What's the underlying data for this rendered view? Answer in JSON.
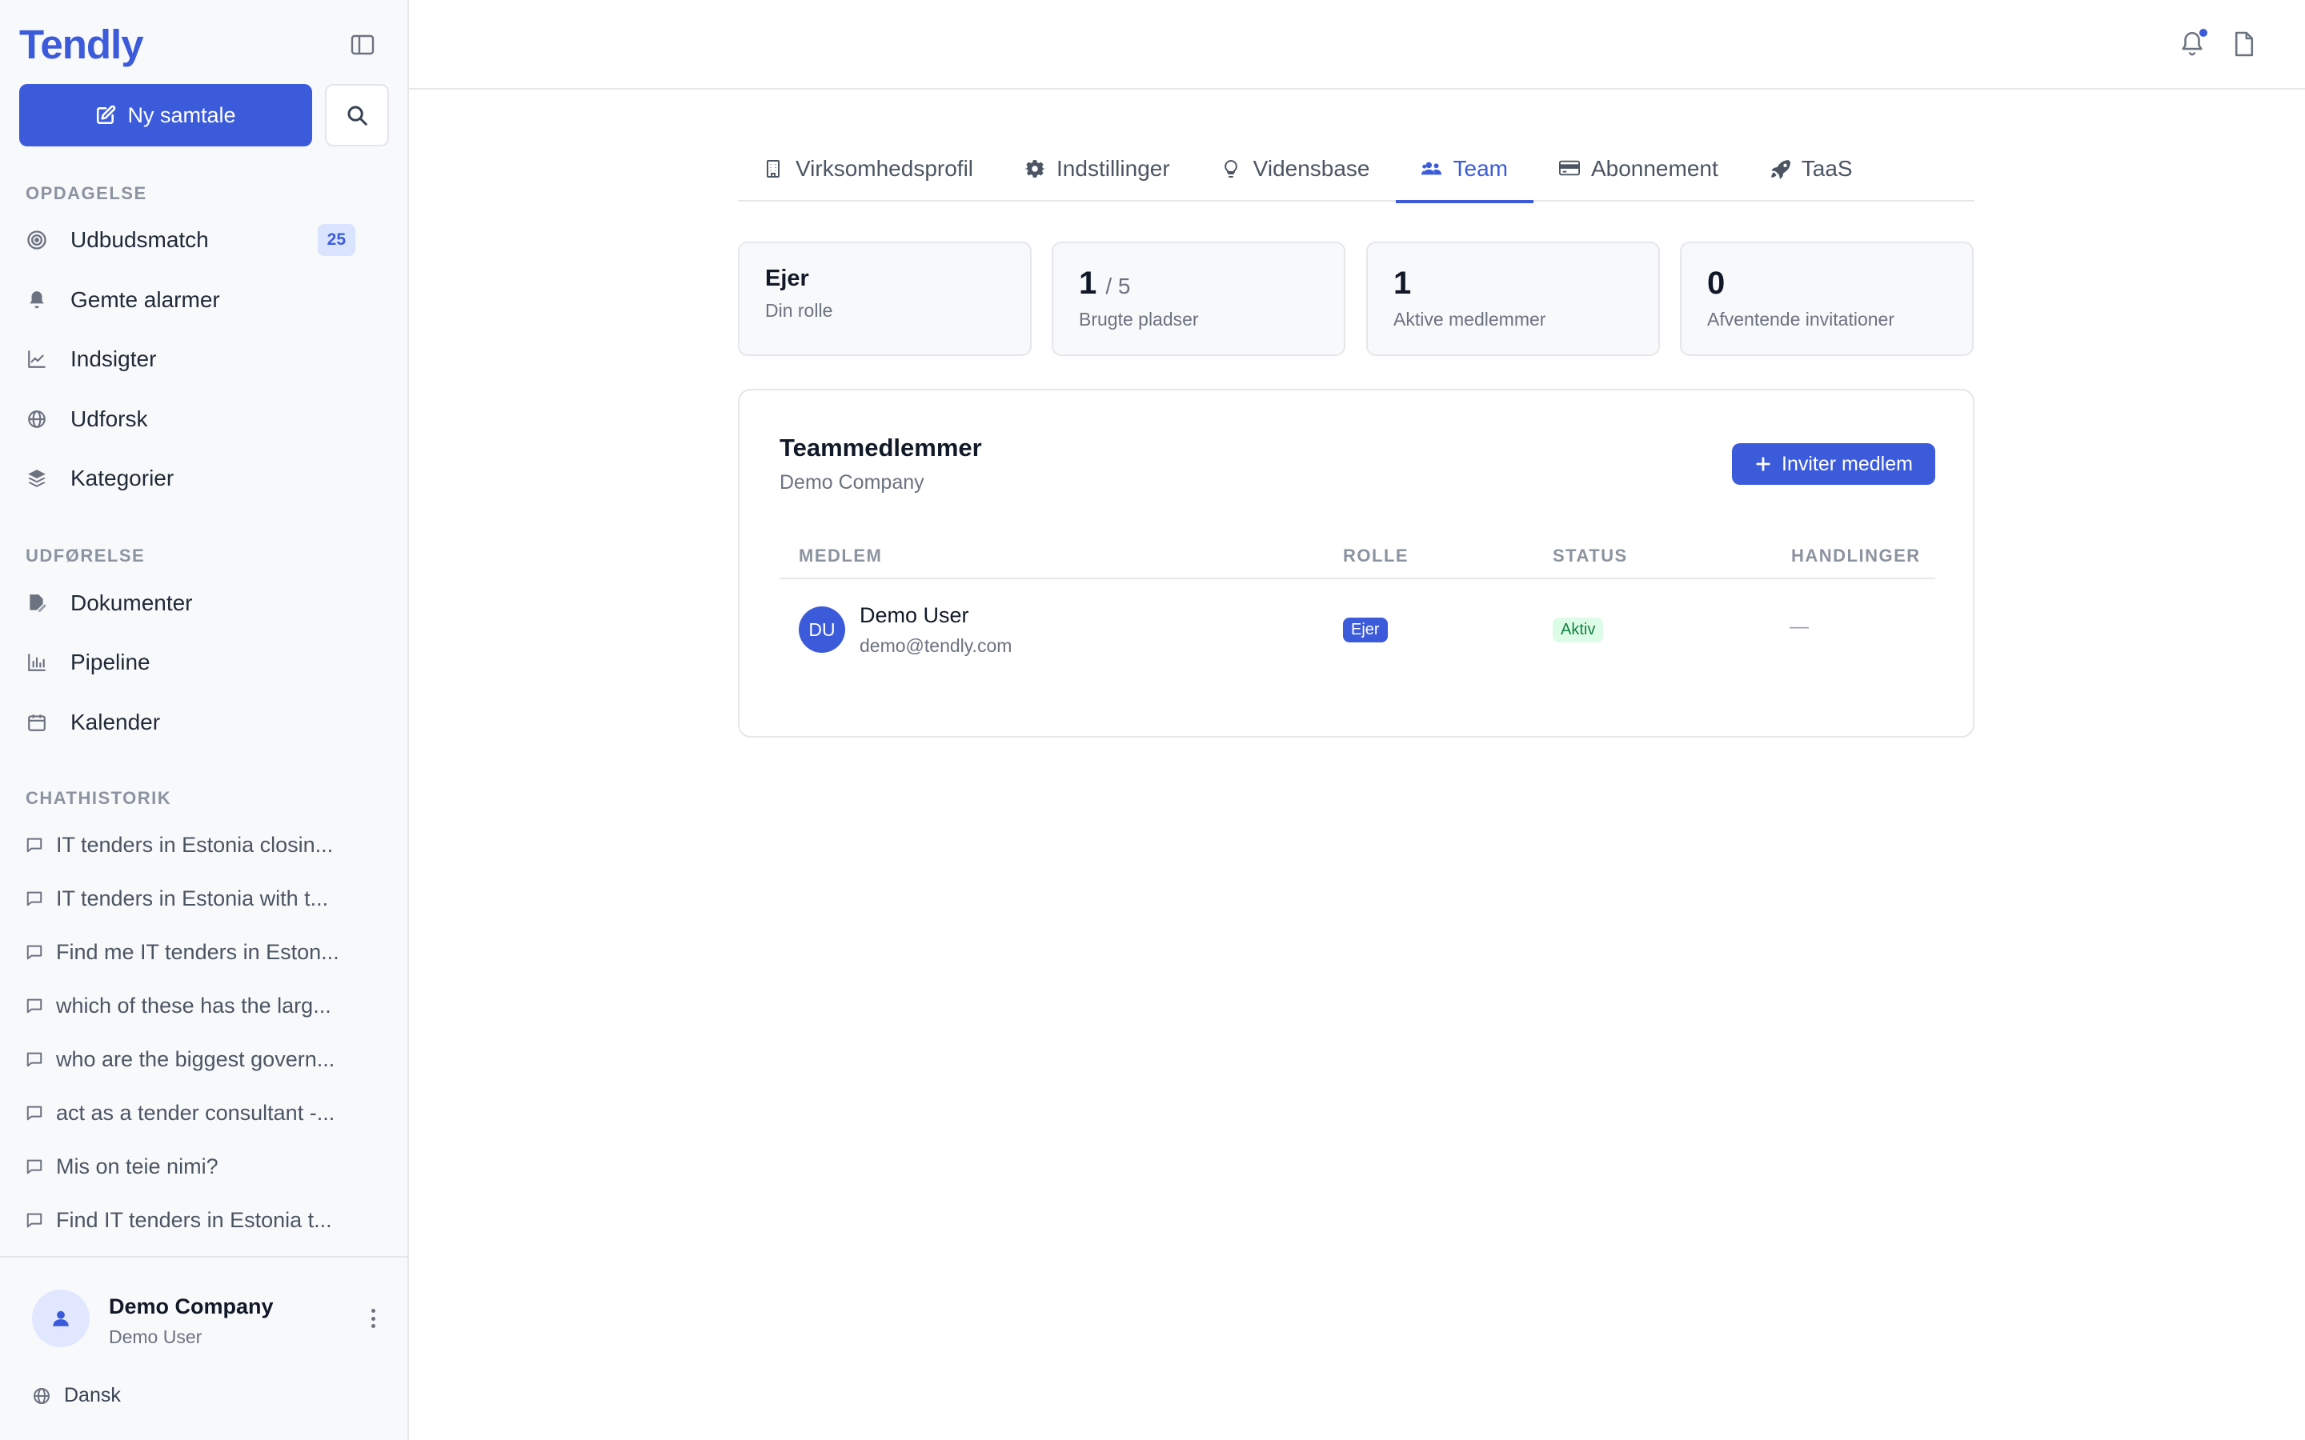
{
  "app": {
    "logo": "Tendly"
  },
  "sidebar": {
    "new_chat_label": "Ny samtale",
    "sections": {
      "discovery": "OPDAGELSE",
      "execution": "UDFØRELSE",
      "history": "CHATHISTORIK"
    },
    "discovery_items": [
      {
        "label": "Udbudsmatch",
        "icon": "target-icon",
        "badge": "25"
      },
      {
        "label": "Gemte alarmer",
        "icon": "bell-icon"
      },
      {
        "label": "Indsigter",
        "icon": "chart-line-icon"
      },
      {
        "label": "Udforsk",
        "icon": "globe-icon"
      },
      {
        "label": "Kategorier",
        "icon": "layers-icon"
      }
    ],
    "execution_items": [
      {
        "label": "Dokumenter",
        "icon": "file-edit-icon"
      },
      {
        "label": "Pipeline",
        "icon": "bar-chart-icon"
      },
      {
        "label": "Kalender",
        "icon": "calendar-icon"
      }
    ],
    "chat_history": [
      "IT tenders in Estonia closin...",
      "IT tenders in Estonia with t...",
      "Find me IT tenders in Eston...",
      "which of these has the larg...",
      "who are the biggest govern...",
      "act as a tender consultant -...",
      "Mis on teie nimi?",
      "Find IT tenders in Estonia t..."
    ],
    "footer": {
      "company": "Demo Company",
      "user": "Demo User",
      "language": "Dansk"
    }
  },
  "tabs": [
    {
      "label": "Virksomhedsprofil",
      "icon": "building-icon",
      "active": false
    },
    {
      "label": "Indstillinger",
      "icon": "gear-icon",
      "active": false
    },
    {
      "label": "Vidensbase",
      "icon": "lightbulb-icon",
      "active": false
    },
    {
      "label": "Team",
      "icon": "users-icon",
      "active": true
    },
    {
      "label": "Abonnement",
      "icon": "credit-card-icon",
      "active": false
    },
    {
      "label": "TaaS",
      "icon": "rocket-icon",
      "active": false
    }
  ],
  "stats": {
    "role": {
      "value": "Ejer",
      "label": "Din rolle"
    },
    "seats": {
      "value": "1",
      "total": "/ 5",
      "label": "Brugte pladser"
    },
    "active": {
      "value": "1",
      "label": "Aktive medlemmer"
    },
    "pending": {
      "value": "0",
      "label": "Afventende invitationer"
    }
  },
  "team": {
    "title": "Teammedlemmer",
    "company": "Demo Company",
    "invite_label": "Inviter medlem",
    "columns": [
      "MEDLEM",
      "ROLLE",
      "STATUS",
      "HANDLINGER"
    ],
    "members": [
      {
        "initials": "DU",
        "name": "Demo User",
        "email": "demo@tendly.com",
        "role": "Ejer",
        "status": "Aktiv",
        "actions": "—"
      }
    ]
  },
  "colors": {
    "accent": "#3b5bdb",
    "status_active_bg": "#dcfce7",
    "status_active_fg": "#15803d"
  }
}
